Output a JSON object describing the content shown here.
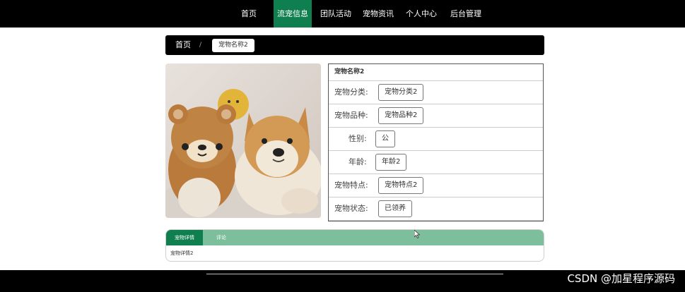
{
  "nav": {
    "items": [
      {
        "label": "首页",
        "active": false
      },
      {
        "label": "流宠信息",
        "active": true
      },
      {
        "label": "团队活动",
        "active": false
      },
      {
        "label": "宠物资讯",
        "active": false
      },
      {
        "label": "个人中心",
        "active": false
      },
      {
        "label": "后台管理",
        "active": false
      }
    ]
  },
  "breadcrumb": {
    "home": "首页",
    "separator": "/",
    "current": "宠物名称2"
  },
  "pet": {
    "image_icon": "pet-photo-teddy-and-shiba",
    "title": "宠物名称2",
    "fields": [
      {
        "label": "宠物分类:",
        "value": "宠物分类2"
      },
      {
        "label": "宠物品种:",
        "value": "宠物品种2"
      },
      {
        "label": "性别:",
        "value": "公"
      },
      {
        "label": "年龄:",
        "value": "年龄2"
      },
      {
        "label": "宠物特点:",
        "value": "宠物特点2"
      },
      {
        "label": "宠物状态:",
        "value": "已领养"
      }
    ]
  },
  "tabs": {
    "items": [
      {
        "label": "宠物详情",
        "active": true
      },
      {
        "label": "评论",
        "active": false
      }
    ],
    "content": "宠物详情2"
  },
  "watermark": "CSDN @加星程序源码",
  "colors": {
    "accent": "#0f7f4f",
    "tab_bar": "#7dbf9c",
    "header": "#000000"
  }
}
